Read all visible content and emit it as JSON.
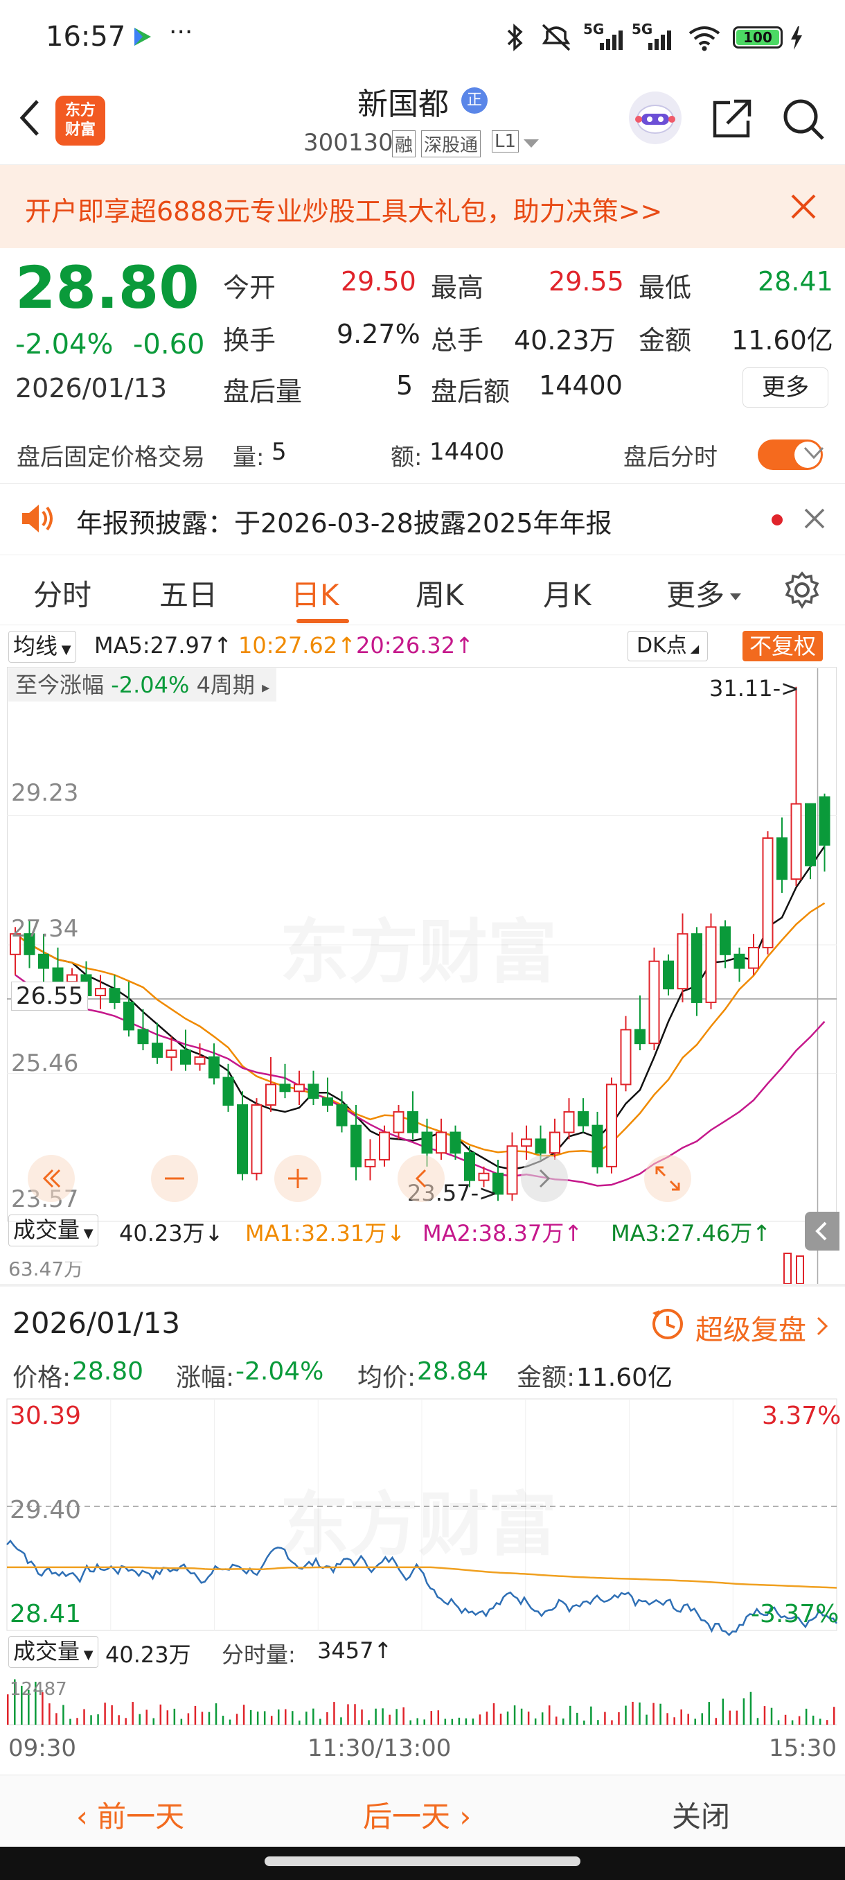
{
  "status_bar": {
    "time": "16:57",
    "dots": "···",
    "network": "5G",
    "network2": "5G",
    "battery": "100"
  },
  "header": {
    "stock_name": "新国都",
    "badge": "正",
    "code": "300130",
    "tags": [
      "融",
      "深股通",
      "L1"
    ]
  },
  "promo": {
    "text": "开户即享超6888元专业炒股工具大礼包，助力决策>>"
  },
  "quote": {
    "price": "28.80",
    "change_pct": "-2.04%",
    "change": "-0.60",
    "date": "2026/01/13",
    "fields": [
      {
        "label": "今开",
        "value": "29.50",
        "color": "red"
      },
      {
        "label": "最高",
        "value": "29.55",
        "color": "red"
      },
      {
        "label": "最低",
        "value": "28.41",
        "color": "green"
      },
      {
        "label": "换手",
        "value": "9.27%",
        "color": "dark"
      },
      {
        "label": "总手",
        "value": "40.23万",
        "color": "dark"
      },
      {
        "label": "金额",
        "value": "11.60亿",
        "color": "dark"
      },
      {
        "label": "盘后量",
        "value": "5",
        "color": "dark"
      },
      {
        "label": "盘后额",
        "value": "14400",
        "color": "dark"
      }
    ],
    "more_button": "更多"
  },
  "after_hours": {
    "title": "盘后固定价格交易",
    "vol_label": "量:",
    "vol": "5",
    "amt_label": "额:",
    "amt": "14400",
    "toggle_label": "盘后分时"
  },
  "notice": {
    "text": "年报预披露：于2026-03-28披露2025年年报"
  },
  "tabs": [
    {
      "label": "分时"
    },
    {
      "label": "五日"
    },
    {
      "label": "日K",
      "active": true
    },
    {
      "label": "周K"
    },
    {
      "label": "月K"
    },
    {
      "label": "更多"
    }
  ],
  "kline": {
    "ma_selector": "均线",
    "ma5": "MA5:27.97↑",
    "ma10": "10:27.62↑",
    "ma20": "20:26.32↑",
    "dk_button": "DK点",
    "adjust_button": "不复权",
    "range_label": "至今涨幅",
    "range_value": "-2.04%",
    "period": "4周期",
    "y_labels": [
      "29.23",
      "27.34",
      "26.55",
      "25.46",
      "23.57"
    ],
    "high_marker": "31.11->",
    "low_marker": "23.57->",
    "watermark": "东方财富",
    "vol_selector": "成交量",
    "vol_value": "40.23万↓",
    "vol_ma1": "MA1:32.31万↓",
    "vol_ma2": "MA2:38.37万↑",
    "vol_ma3": "MA3:27.46万↑",
    "vol_axis": "63.47万"
  },
  "chart_data": {
    "type": "candlestick",
    "ma_series": [
      {
        "name": "MA5"
      },
      {
        "name": "MA10"
      },
      {
        "name": "MA20"
      }
    ],
    "candles": [
      [
        27.2,
        27.6,
        26.9,
        27.5
      ],
      [
        27.5,
        27.7,
        27.0,
        27.2
      ],
      [
        27.2,
        27.5,
        26.8,
        27.0
      ],
      [
        27.0,
        27.3,
        26.7,
        26.8
      ],
      [
        26.8,
        27.0,
        26.6,
        26.9
      ],
      [
        26.9,
        27.1,
        26.5,
        26.6
      ],
      [
        26.6,
        26.9,
        26.4,
        26.7
      ],
      [
        26.7,
        26.9,
        26.4,
        26.5
      ],
      [
        26.5,
        26.8,
        26.0,
        26.1
      ],
      [
        26.1,
        26.4,
        25.8,
        25.9
      ],
      [
        25.9,
        26.2,
        25.6,
        25.7
      ],
      [
        25.7,
        26.0,
        25.5,
        25.8
      ],
      [
        25.8,
        26.1,
        25.5,
        25.6
      ],
      [
        25.6,
        25.9,
        25.5,
        25.7
      ],
      [
        25.7,
        25.9,
        25.3,
        25.4
      ],
      [
        25.4,
        25.6,
        24.9,
        25.0
      ],
      [
        25.0,
        25.2,
        23.9,
        24.0
      ],
      [
        24.0,
        25.1,
        23.9,
        25.0
      ],
      [
        25.0,
        25.7,
        24.9,
        25.3
      ],
      [
        25.3,
        25.6,
        25.1,
        25.2
      ],
      [
        25.2,
        25.5,
        25.0,
        25.3
      ],
      [
        25.3,
        25.5,
        25.0,
        25.1
      ],
      [
        25.1,
        25.4,
        24.9,
        25.0
      ],
      [
        25.0,
        25.2,
        24.6,
        24.7
      ],
      [
        24.7,
        25.0,
        23.9,
        24.1
      ],
      [
        24.1,
        24.5,
        23.9,
        24.2
      ],
      [
        24.2,
        24.7,
        24.1,
        24.6
      ],
      [
        24.6,
        25.0,
        24.5,
        24.9
      ],
      [
        24.9,
        25.2,
        24.5,
        24.6
      ],
      [
        24.6,
        24.8,
        24.1,
        24.3
      ],
      [
        24.3,
        24.8,
        24.2,
        24.6
      ],
      [
        24.6,
        24.7,
        24.2,
        24.3
      ],
      [
        24.3,
        24.4,
        23.8,
        23.9
      ],
      [
        23.9,
        24.1,
        23.8,
        24.0
      ],
      [
        24.0,
        24.2,
        23.6,
        23.7
      ],
      [
        23.7,
        24.6,
        23.6,
        24.4
      ],
      [
        24.4,
        24.7,
        24.2,
        24.5
      ],
      [
        24.5,
        24.7,
        24.2,
        24.3
      ],
      [
        24.3,
        24.8,
        24.2,
        24.6
      ],
      [
        24.6,
        25.1,
        24.5,
        24.9
      ],
      [
        24.9,
        25.1,
        24.6,
        24.7
      ],
      [
        24.7,
        24.9,
        24.0,
        24.1
      ],
      [
        24.1,
        25.4,
        24.0,
        25.3
      ],
      [
        25.3,
        26.3,
        25.2,
        26.1
      ],
      [
        26.1,
        26.6,
        25.8,
        25.9
      ],
      [
        25.9,
        27.3,
        25.8,
        27.1
      ],
      [
        27.1,
        27.2,
        26.6,
        26.7
      ],
      [
        26.7,
        27.8,
        26.5,
        27.5
      ],
      [
        27.5,
        27.6,
        26.3,
        26.5
      ],
      [
        26.5,
        27.8,
        26.4,
        27.6
      ],
      [
        27.6,
        27.7,
        27.0,
        27.2
      ],
      [
        27.2,
        27.3,
        26.8,
        27.0
      ],
      [
        27.0,
        27.5,
        26.9,
        27.3
      ],
      [
        27.3,
        29.0,
        27.2,
        28.9
      ],
      [
        28.9,
        29.2,
        28.1,
        28.3
      ],
      [
        28.3,
        31.11,
        28.2,
        29.4
      ],
      [
        29.4,
        29.4,
        28.3,
        28.5
      ],
      [
        29.5,
        29.55,
        28.41,
        28.8
      ]
    ]
  },
  "detail": {
    "date": "2026/01/13",
    "replay": "超级复盘",
    "price_label": "价格:",
    "price": "28.80",
    "chg_label": "涨幅:",
    "chg": "-2.04%",
    "avg_label": "均价:",
    "avg": "28.84",
    "amt_label": "金额:",
    "amt": "11.60亿",
    "y_top": "30.39",
    "y_mid": "29.40",
    "y_bot": "28.41",
    "pct_top": "3.37%",
    "pct_bot": "-3.37%",
    "vol_selector": "成交量",
    "vol": "40.23万",
    "min_vol_label": "分时量:",
    "min_vol": "3457↑",
    "vol_axis": "12487",
    "time_start": "09:30",
    "time_mid": "11:30/13:00",
    "time_end": "15:30"
  },
  "bottom_nav": {
    "prev": "前一天",
    "next": "后一天",
    "close": "关闭"
  },
  "colors": {
    "up": "#e0242b",
    "down": "#0a9a3a",
    "ma5": "#111111",
    "ma10": "#f08a00",
    "ma20": "#c5188b",
    "price_line": "#2e6fb5",
    "avg_line": "#f0a020",
    "accent": "#f06020"
  }
}
